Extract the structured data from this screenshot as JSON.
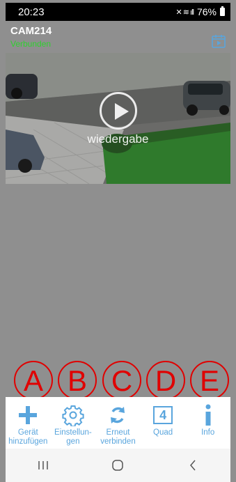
{
  "status_bar": {
    "time": "20:23",
    "signal": "✴ ◢.∥",
    "battery": "76%"
  },
  "header": {
    "camera_name": "CAM214",
    "connection_status": "Verbunden"
  },
  "video": {
    "overlay_label": "wiedergabe"
  },
  "markers": [
    "A",
    "B",
    "C",
    "D",
    "E"
  ],
  "toolbar": {
    "items": [
      {
        "label": "Gerät\nhinzufügen",
        "icon": "plus-icon"
      },
      {
        "label": "Einstellun-\ngen",
        "icon": "gear-icon"
      },
      {
        "label": "Erneut\nverbinden",
        "icon": "refresh-icon"
      },
      {
        "label": "Quad",
        "icon": "quad-icon",
        "quad_value": "4"
      },
      {
        "label": "Info",
        "icon": "info-icon"
      }
    ]
  },
  "colors": {
    "accent": "#59a5dd",
    "connected": "#2fd12f",
    "marker": "#e00000"
  }
}
